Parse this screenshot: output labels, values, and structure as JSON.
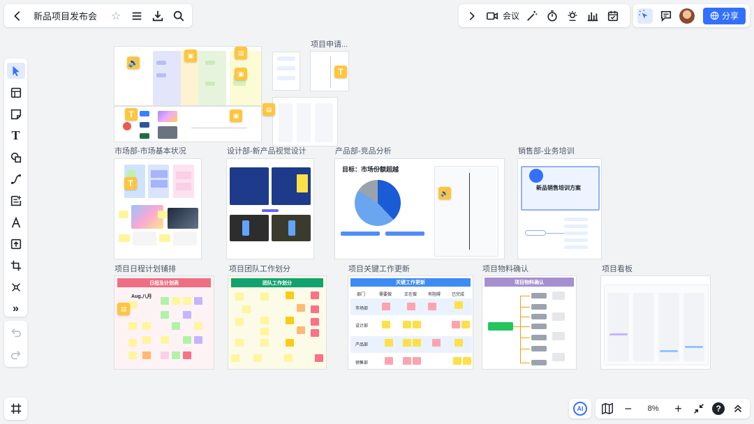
{
  "header": {
    "doc_title": "新品项目发布会",
    "meeting_label": "会议",
    "share_label": "分享"
  },
  "zoom": {
    "value": "8%"
  },
  "frames": [
    {
      "id": "apply",
      "label": "项目申请..."
    },
    {
      "id": "market",
      "label": "市场部-市场基本状况"
    },
    {
      "id": "design",
      "label": "设计部-新产品视觉设计"
    },
    {
      "id": "product",
      "label": "产品部-竞品分析"
    },
    {
      "id": "sales",
      "label": "销售部-业务培训"
    },
    {
      "id": "schedule",
      "label": "项目日程计划铺排"
    },
    {
      "id": "team",
      "label": "项目团队工作划分"
    },
    {
      "id": "keywork",
      "label": "项目关键工作更新"
    },
    {
      "id": "material",
      "label": "项目物料确认"
    },
    {
      "id": "kanban",
      "label": "项目看板"
    }
  ],
  "product_frame": {
    "goal": "目标：市场份额超越"
  },
  "sales_frame": {
    "plan_title": "新品销售培训方案"
  },
  "schedule_frame": {
    "header": "日程及计划表",
    "month": "Aug.八月"
  },
  "team_frame": {
    "header": "团队工作划分"
  },
  "keywork_frame": {
    "header": "关键工作更新",
    "columns": [
      "部门",
      "需要做",
      "正在做",
      "有阻碍",
      "已完成"
    ],
    "rows": [
      "市场部",
      "设计部",
      "产品部",
      "销售部"
    ]
  },
  "material_frame": {
    "header": "项目物料确认"
  },
  "colors": {
    "accent": "#3370ff",
    "canvas": "#f2f3f5"
  },
  "icons": [
    "back-icon",
    "star-icon",
    "menu-icon",
    "download-icon",
    "search-icon",
    "chevron-right-icon",
    "video-icon",
    "magic-wand-icon",
    "timer-icon",
    "spotlight-icon",
    "chart-icon",
    "calendar-check-icon",
    "laser-pointer-icon",
    "comment-icon",
    "globe-icon"
  ]
}
